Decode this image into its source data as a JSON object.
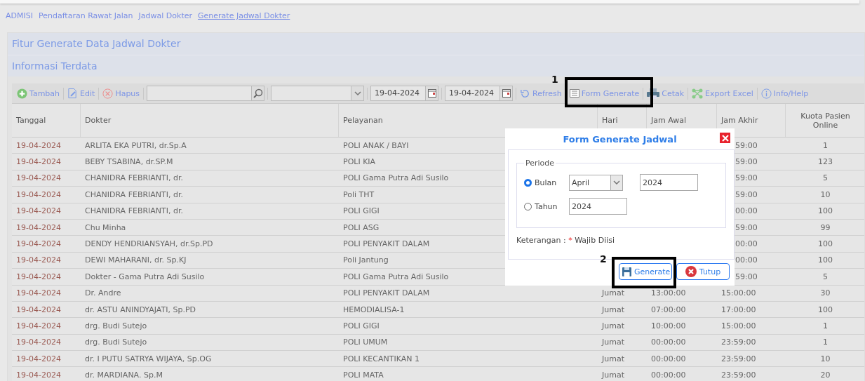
{
  "breadcrumb": [
    {
      "label": "ADMISI",
      "selected": false
    },
    {
      "label": "Pendaftaran Rawat Jalan",
      "selected": false
    },
    {
      "label": "Jadwal Dokter",
      "selected": false
    },
    {
      "label": "Generate Jadwal Dokter",
      "selected": true
    }
  ],
  "panel_title": "Fitur Generate Data Jadwal Dokter",
  "section_title": "Informasi Terdata",
  "toolbar": [
    {
      "kind": "button",
      "label": "Tambah"
    },
    {
      "kind": "button",
      "label": "Edit"
    },
    {
      "kind": "button",
      "label": "Hapus"
    },
    {
      "kind": "search"
    },
    {
      "kind": "select"
    },
    {
      "kind": "date",
      "value": "19-04-2024"
    },
    {
      "kind": "date",
      "value": "19-04-2024"
    },
    {
      "kind": "button",
      "label": "Refresh"
    },
    {
      "kind": "button",
      "label": "Form Generate"
    },
    {
      "kind": "button",
      "label": "Cetak"
    },
    {
      "kind": "button",
      "label": "Export Excel"
    },
    {
      "kind": "button",
      "label": "Info/Help"
    }
  ],
  "table": {
    "columns": [
      "Tanggal",
      "Dokter",
      "Pelayanan",
      "Hari",
      "Jam Awal",
      "Jam Akhir",
      "Kuota Pasien Online"
    ],
    "rows": [
      {
        "tanggal": "19-04-2024",
        "dokter": "ARLITA EKA PUTRI, dr.Sp.A",
        "pelayanan": "POLI ANAK / BAYI",
        "jam_akhir": "59:00",
        "kuota": "1"
      },
      {
        "tanggal": "19-04-2024",
        "dokter": "BEBY TSABINA, dr.SP.M",
        "pelayanan": "POLI KIA",
        "jam_akhir": "59:00",
        "kuota": "123"
      },
      {
        "tanggal": "19-04-2024",
        "dokter": "CHANIDRA FEBRIANTI, dr.",
        "pelayanan": "POLI Gama Putra Adi Susilo",
        "jam_akhir": "59:00",
        "kuota": "5"
      },
      {
        "tanggal": "19-04-2024",
        "dokter": "CHANIDRA FEBRIANTI, dr.",
        "pelayanan": "Poli THT",
        "jam_akhir": "59:00",
        "kuota": "10"
      },
      {
        "tanggal": "19-04-2024",
        "dokter": "CHANIDRA FEBRIANTI, dr.",
        "pelayanan": "POLI GIGI",
        "jam_akhir": "00:00",
        "kuota": "100"
      },
      {
        "tanggal": "19-04-2024",
        "dokter": "Chu Minha",
        "pelayanan": "POLI ASG",
        "jam_akhir": "59:00",
        "kuota": "99"
      },
      {
        "tanggal": "19-04-2024",
        "dokter": "DENDY HENDRIANSYAH, dr.Sp.PD",
        "pelayanan": "POLI PENYAKIT DALAM",
        "jam_akhir": "00:00",
        "kuota": "100"
      },
      {
        "tanggal": "19-04-2024",
        "dokter": "DEWI MAHARANI, dr. Sp.KJ",
        "pelayanan": "Poli Jantung",
        "jam_akhir": "00:00",
        "kuota": "100"
      },
      {
        "tanggal": "19-04-2024",
        "dokter": "Dokter - Gama Putra Adi Susilo",
        "pelayanan": "POLI Gama Putra Adi Susilo",
        "jam_akhir": "59:00",
        "kuota": "5"
      },
      {
        "tanggal": "19-04-2024",
        "dokter": "Dr. Andre",
        "pelayanan": "POLI PENYAKIT DALAM",
        "hari": "Jumat",
        "jam_awal": "13:00:00",
        "jam_akhir": "15:00:00",
        "kuota": "30"
      },
      {
        "tanggal": "19-04-2024",
        "dokter": "dr. ASTU ANINDYAJATI, Sp.PD",
        "pelayanan": "HEMODIALISA-1",
        "hari": "Jumat",
        "jam_awal": "07:00:00",
        "jam_akhir": "17:00:00",
        "kuota": "100"
      },
      {
        "tanggal": "19-04-2024",
        "dokter": "drg. Budi Sutejo",
        "pelayanan": "POLI GIGI",
        "hari": "Jumat",
        "jam_awal": "10:00:00",
        "jam_akhir": "15:00:00",
        "kuota": "1"
      },
      {
        "tanggal": "19-04-2024",
        "dokter": "drg. Budi Sutejo",
        "pelayanan": "POLI UMUM",
        "hari": "Jumat",
        "jam_awal": "00:00:00",
        "jam_akhir": "23:59:00",
        "kuota": "1"
      },
      {
        "tanggal": "19-04-2024",
        "dokter": "dr. I PUTU SATRYA WIJAYA, Sp.OG",
        "pelayanan": "POLI KECANTIKAN 1",
        "hari": "Jumat",
        "jam_awal": "00:00:00",
        "jam_akhir": "23:59:00",
        "kuota": "10"
      },
      {
        "tanggal": "19-04-2024",
        "dokter": "dr. MARDIANA. Sp.M",
        "pelayanan": "POLI MATA",
        "hari": "Jumat",
        "jam_awal": "00:00:00",
        "jam_akhir": "23:59:00",
        "kuota": "20"
      }
    ]
  },
  "modal": {
    "title": "Form Generate Jadwal",
    "legend": "Periode",
    "options": [
      {
        "label": "Bulan",
        "selected": true,
        "fields": [
          {
            "kind": "select",
            "value": "April"
          },
          {
            "kind": "input",
            "value": "2024"
          }
        ]
      },
      {
        "label": "Tahun",
        "selected": false,
        "fields": [
          {
            "kind": "input",
            "value": "2024"
          }
        ]
      }
    ],
    "note": {
      "label": "Keterangan :",
      "mark": "*",
      "text": "Wajib Diisi"
    },
    "buttons": [
      {
        "label": "Generate"
      },
      {
        "label": "Tutup"
      }
    ]
  },
  "annotations": [
    {
      "label": "1"
    },
    {
      "label": "2"
    }
  ]
}
